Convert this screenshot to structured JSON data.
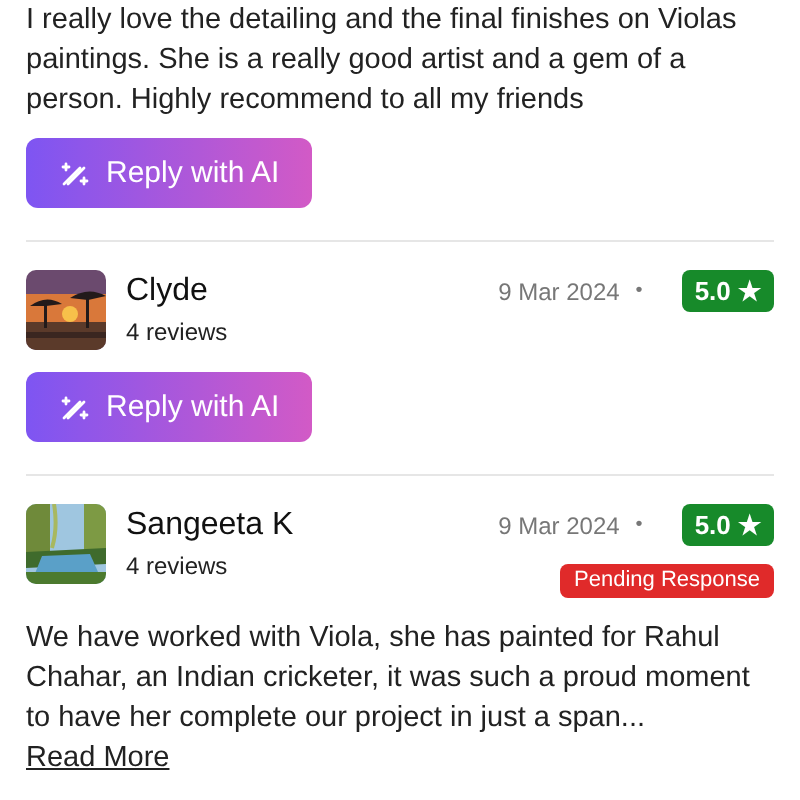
{
  "reviews": [
    {
      "text": "I really love the detailing and the final finishes on Violas paintings. She is a really good artist and a gem of a person. Highly recommend to all my friends",
      "reply_button": "Reply with AI"
    },
    {
      "name": "Clyde",
      "review_count": "4 reviews",
      "date": "9 Mar 2024",
      "separator": "•",
      "rating": "5.0 ★",
      "reply_button": "Reply with AI"
    },
    {
      "name": "Sangeeta K",
      "review_count": "4 reviews",
      "date": "9 Mar 2024",
      "separator": "•",
      "rating": "5.0 ★",
      "status": "Pending Response",
      "text": "We have worked with Viola, she has painted for Rahul Chahar, an Indian cricketer, it was such a proud moment to have her complete our project in just a span...",
      "read_more": "Read More"
    }
  ]
}
